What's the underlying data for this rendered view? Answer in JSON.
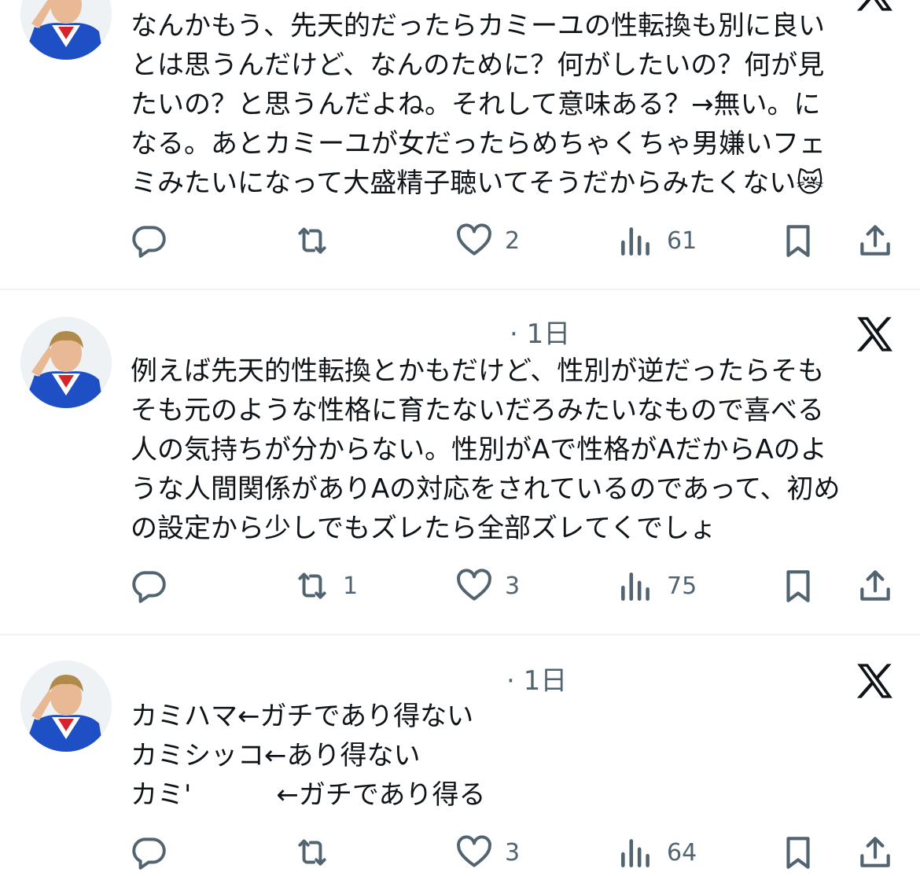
{
  "colors": {
    "text": "#0f1419",
    "secondary": "#536471",
    "divider": "#eff3f4",
    "icon": "#536471"
  },
  "icons": {
    "reply": "reply-icon",
    "repost": "repost-icon",
    "like": "like-icon",
    "views": "views-icon",
    "bookmark": "bookmark-icon",
    "share": "share-icon",
    "brand": "x-logo-icon"
  },
  "posts": [
    {
      "time": "",
      "lines": [
        "なんかもう、先天的だったらカミーユの性転換も別に良い",
        "とは思うんだけど、なんのために？何がしたいの？何が見",
        "たいの？と思うんだよね。それして意味ある？→無い。に",
        "なる。あとカミーユが女だったらめちゃくちゃ男嫌いフェ",
        "ミみたいになって大盛精子聴いてそうだからみたくない😿"
      ],
      "reply_count": "",
      "repost_count": "",
      "like_count": "2",
      "view_count": "61"
    },
    {
      "time": "· 1日",
      "lines": [
        "例えば先天的性転換とかもだけど、性別が逆だったらそも",
        "そも元のような性格に育たないだろみたいなもので喜べる",
        "人の気持ちが分からない。性別がAで性格がAだからAのよ",
        "うな人間関係がありAの対応をされているのであって、初め",
        "の設定から少しでもズレたら全部ズレてくでしょ"
      ],
      "reply_count": "",
      "repost_count": "1",
      "like_count": "3",
      "view_count": "75"
    },
    {
      "time": "· 1日",
      "lines": [
        "カミハマ←ガチであり得ない",
        "カミシッコ←あり得ない"
      ],
      "line3_prefix": "カミ'",
      "line3_suffix": "←ガチであり得る",
      "reply_count": "",
      "repost_count": "",
      "like_count": "3",
      "view_count": "64"
    }
  ]
}
